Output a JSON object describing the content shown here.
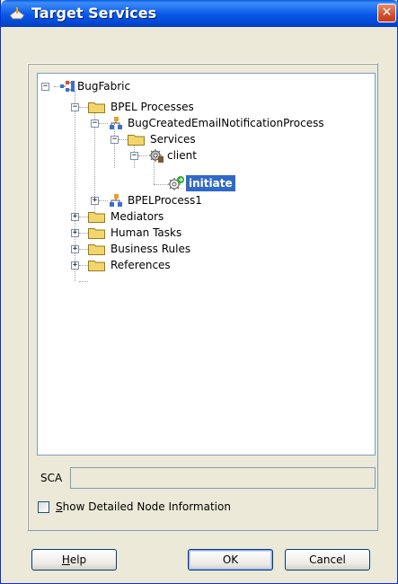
{
  "window": {
    "title": "Target Services",
    "close_glyph": "✕"
  },
  "tree": {
    "root": "BugFabric",
    "bpel_processes": "BPEL Processes",
    "process1": "BugCreatedEmailNotificationProcess",
    "services": "Services",
    "client": "client",
    "initiate": "initiate",
    "process2": "BPELProcess1",
    "mediators": "Mediators",
    "human_tasks": "Human Tasks",
    "business_rules": "Business Rules",
    "references": "References"
  },
  "sca": {
    "label": "SCA",
    "value": ""
  },
  "options": {
    "show_detailed_prefix": "S",
    "show_detailed_rest": "how Detailed Node Information",
    "checked": false
  },
  "buttons": {
    "help_u": "H",
    "help_rest": "elp",
    "ok": "OK",
    "cancel": "Cancel"
  },
  "colors": {
    "selection": "#3169c6",
    "titlebar": "#0858e8",
    "folder": "#f2d66c"
  }
}
